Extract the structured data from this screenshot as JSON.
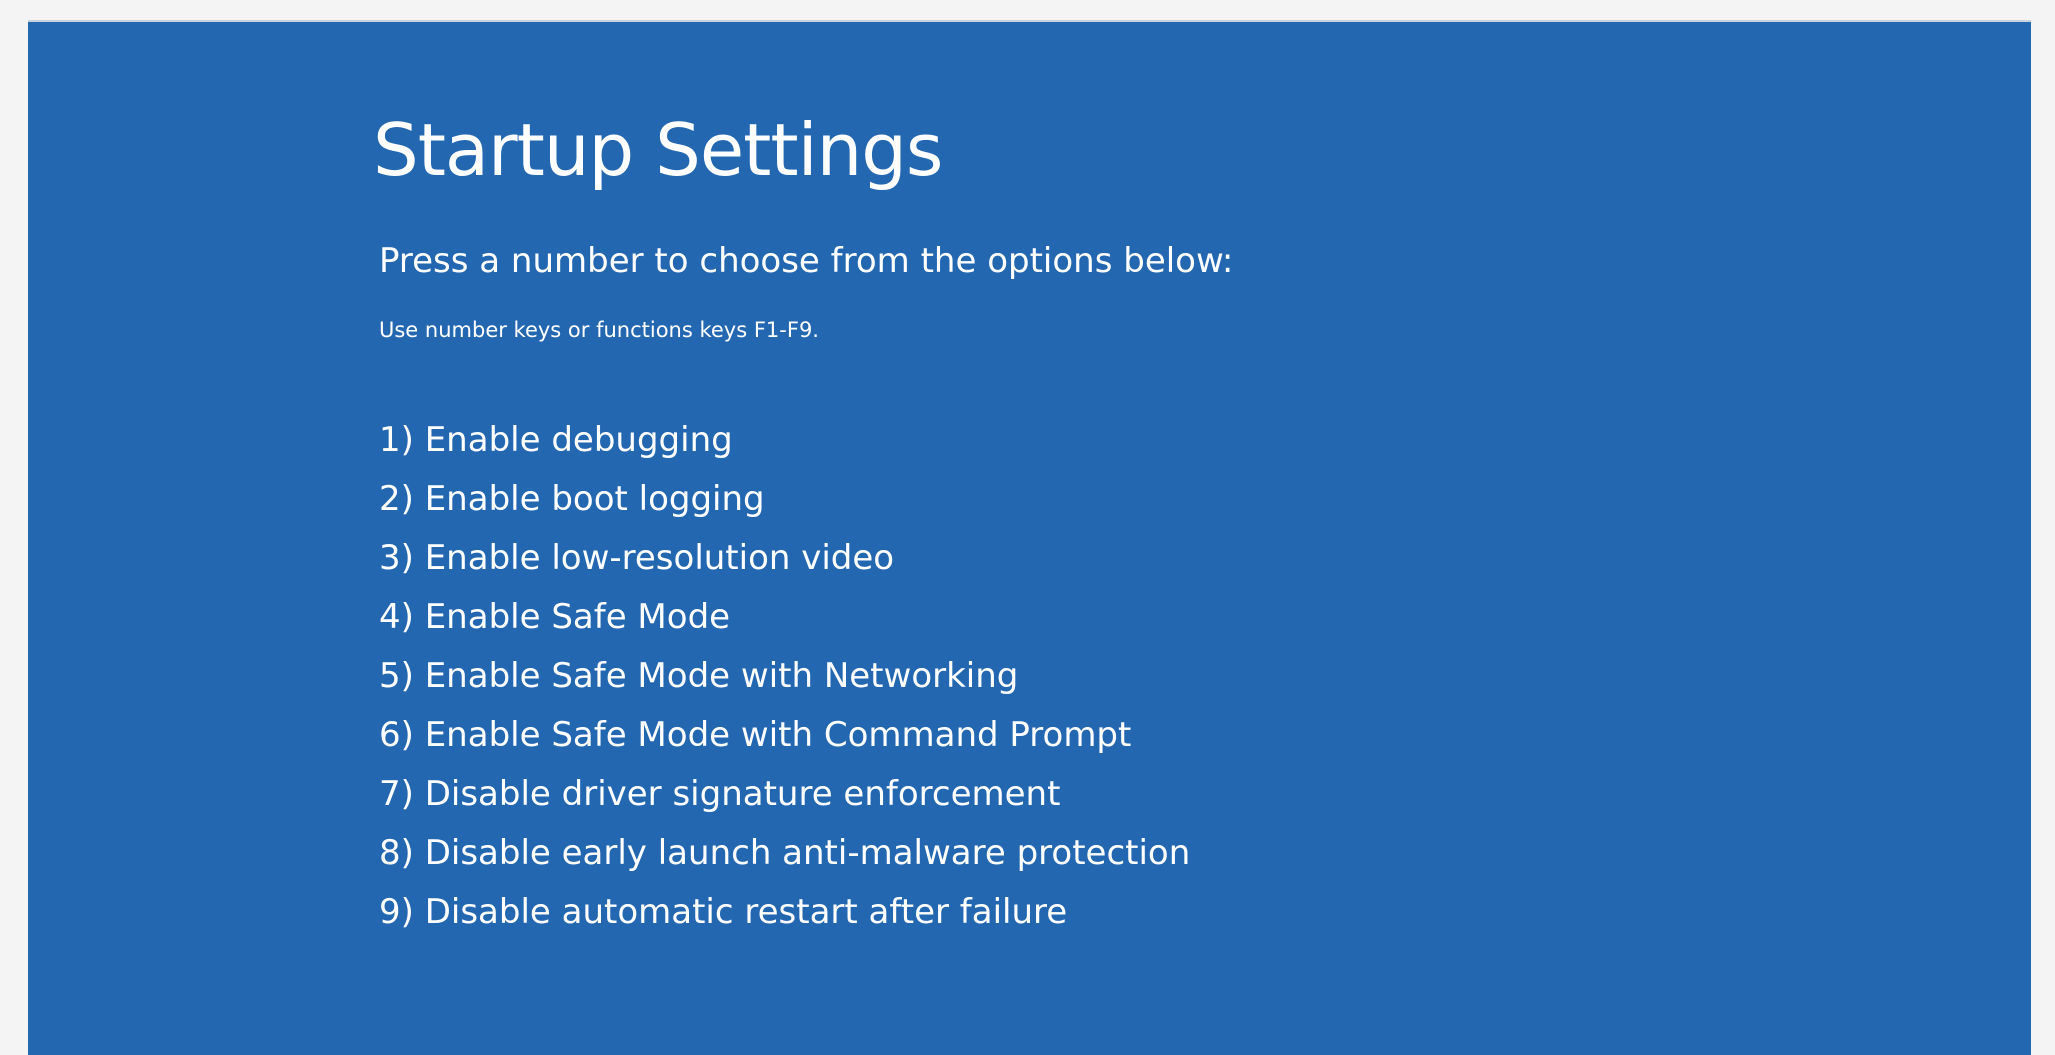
{
  "screen": {
    "title": "Startup Settings",
    "subtitle": "Press a number to choose from the options below:",
    "hint": "Use number keys or functions keys F1-F9."
  },
  "options": [
    "1) Enable debugging",
    "2) Enable boot logging",
    "3) Enable low-resolution video",
    "4) Enable Safe Mode",
    "5) Enable Safe Mode with Networking",
    "6) Enable Safe Mode with Command Prompt",
    "7) Disable driver signature enforcement",
    "8) Disable early launch anti-malware protection",
    "9) Disable automatic restart after failure"
  ],
  "colors": {
    "background": "#2367b1",
    "text": "#ffffff",
    "frame": "#f4f4f4"
  }
}
